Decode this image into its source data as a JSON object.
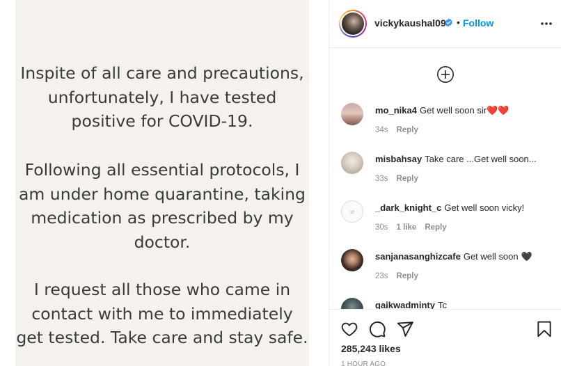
{
  "post": {
    "paragraph1": "Inspite of all care and precautions,\nunfortunately, I have tested\npositive for COVID-19.",
    "paragraph2": "Following all essential protocols, I\nam under home quarantine, taking\nmedication as prescribed by my\ndoctor.",
    "paragraph3": "I request all those who came in\ncontact with me to immediately\nget tested. Take care and stay safe."
  },
  "header": {
    "username": "vickykaushal09",
    "separator": "•",
    "follow_label": "Follow"
  },
  "comments": [
    {
      "user": "mo_nika4",
      "text": "Get well soon sir",
      "emoji": "❤️❤️",
      "age": "34s",
      "likes": "",
      "reply": "Reply"
    },
    {
      "user": "misbahsay",
      "text": "Take care ...Get well soon...",
      "emoji": "",
      "age": "33s",
      "likes": "",
      "reply": "Reply"
    },
    {
      "user": "_dark_knight_c",
      "text": "Get well soon vicky!",
      "emoji": "",
      "age": "30s",
      "likes": "1 like",
      "reply": "Reply"
    },
    {
      "user": "sanjanasanghizcafe",
      "text": "Get well soon",
      "emoji": "🖤",
      "age": "23s",
      "likes": "",
      "reply": "Reply"
    },
    {
      "user": "gaikwadminty",
      "text": "Tc",
      "emoji": "",
      "age": "",
      "likes": "",
      "reply": ""
    }
  ],
  "actions": {
    "likes_count": "285,243",
    "likes_label": "likes",
    "timestamp": "1 HOUR AGO"
  },
  "colors": {
    "accent": "#0095f6",
    "heart": "#ed4956",
    "muted": "#8e8e8e",
    "post_bg": "#f5f2ee"
  },
  "icons": {
    "verified": "verified-badge-icon",
    "more": "more-options-icon",
    "load_more": "plus-circle-icon",
    "like": "heart-icon",
    "comment": "comment-icon",
    "share": "paper-plane-icon",
    "save": "bookmark-icon"
  }
}
